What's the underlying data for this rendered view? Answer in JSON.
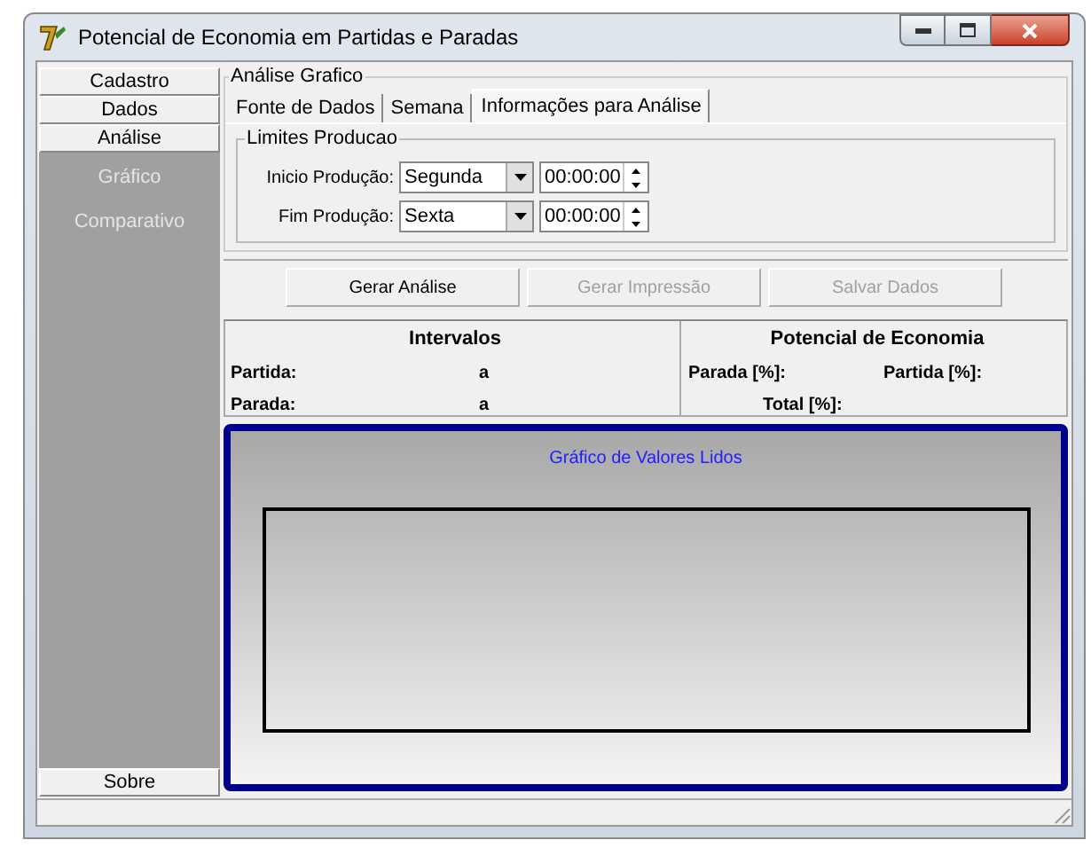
{
  "window": {
    "title": "Potencial de Economia em Partidas e Paradas"
  },
  "sidebar": {
    "buttons": [
      "Cadastro",
      "Dados",
      "Análise"
    ],
    "sub_items": [
      "Gráfico",
      "Comparativo"
    ],
    "bottom_button": "Sobre"
  },
  "group_title": "Análise Grafico",
  "tabs": [
    {
      "label": "Fonte de Dados",
      "selected": false
    },
    {
      "label": "Semana",
      "selected": false
    },
    {
      "label": "Informações para Análise",
      "selected": true
    }
  ],
  "limits": {
    "title": "Limites Producao",
    "rows": [
      {
        "label": "Inicio Produção:",
        "day": "Segunda",
        "time": "00:00:00"
      },
      {
        "label": "Fim Produção:",
        "day": "Sexta",
        "time": "00:00:00"
      }
    ]
  },
  "actions": [
    {
      "label": "Gerar Análise",
      "disabled": false
    },
    {
      "label": "Gerar Impressão",
      "disabled": true
    },
    {
      "label": "Salvar Dados",
      "disabled": true
    }
  ],
  "intervals": {
    "title": "Intervalos",
    "rows": [
      {
        "label": "Partida:",
        "value": "a"
      },
      {
        "label": "Parada:",
        "value": "a"
      }
    ]
  },
  "economy": {
    "title": "Potencial de Economia",
    "parada": "Parada [%]:",
    "partida": "Partida [%]:",
    "total": "Total [%]:"
  },
  "chart": {
    "title": "Gráfico de Valores Lidos"
  }
}
